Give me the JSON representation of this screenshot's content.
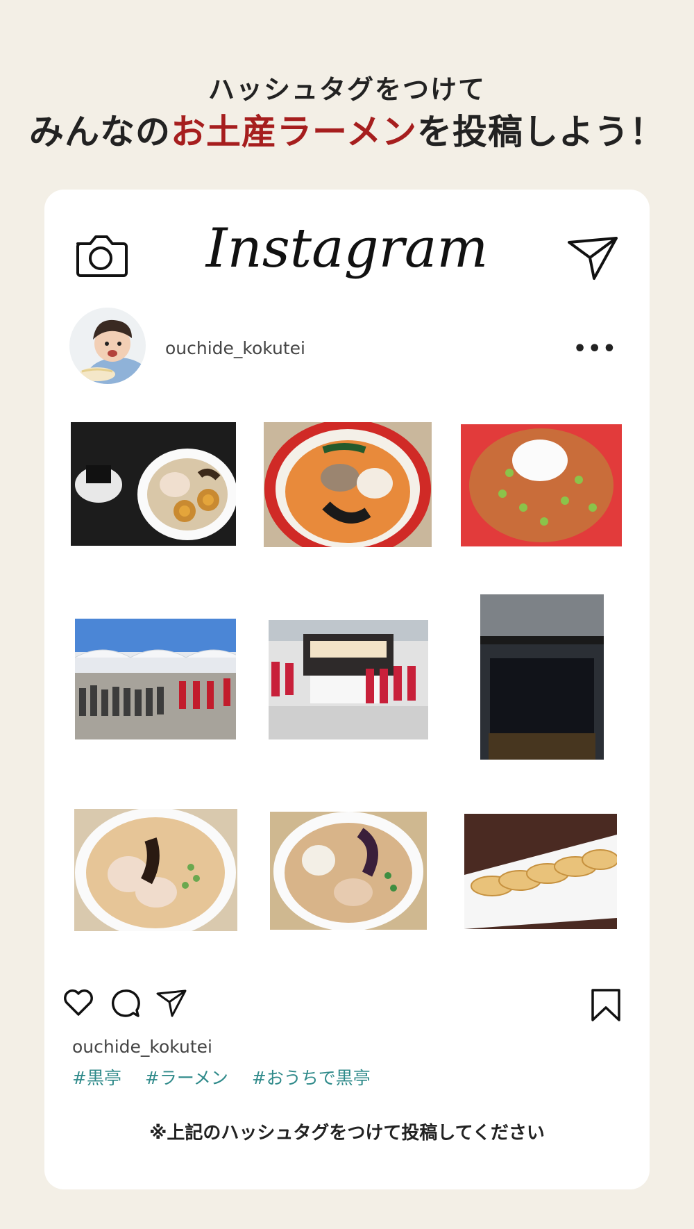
{
  "header": {
    "line1": "ハッシュタグをつけて",
    "line2_pre": "みんなの",
    "line2_accent": "お土産ラーメン",
    "line2_post": "を投稿しよう！"
  },
  "post": {
    "app_logo": "Instagram",
    "username": "ouchide_kokutei",
    "more_label": "•••",
    "caption_user": "ouchide_kokutei",
    "hashtags": [
      "#黒亭",
      "#ラーメン",
      "#おうちで黒亭"
    ],
    "note": "※上記のハッシュタグをつけて投稿してください",
    "icons": [
      "camera-icon",
      "send-icon",
      "heart-icon",
      "comment-icon",
      "share-icon",
      "bookmark-icon"
    ]
  },
  "colors": {
    "background": "#f3efe6",
    "accent_red": "#a61e1e",
    "hashtag_teal": "#2f8a8a"
  }
}
